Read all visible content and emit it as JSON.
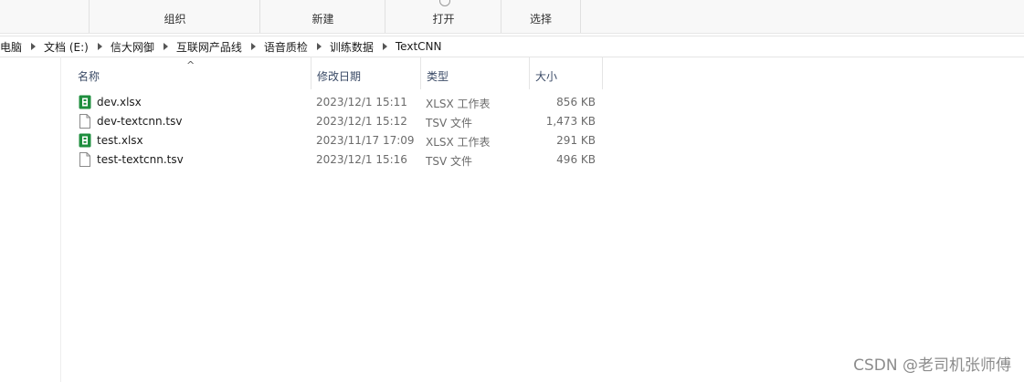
{
  "ribbon": {
    "groups": [
      {
        "label": "组织"
      },
      {
        "label": "新建"
      },
      {
        "label": "打开"
      },
      {
        "label": "选择"
      }
    ]
  },
  "address": {
    "crumbs": [
      "此电脑",
      "文档 (E:)",
      "信大网御",
      "互联网产品线",
      "语音质检",
      "训练数据",
      "TextCNN"
    ]
  },
  "columns": {
    "name": "名称",
    "date": "修改日期",
    "type": "类型",
    "size": "大小",
    "sort_glyph": "^"
  },
  "files": [
    {
      "name": "dev.xlsx",
      "date": "2023/12/1 15:11",
      "type": "XLSX 工作表",
      "size": "856 KB",
      "icon": "excel-icon"
    },
    {
      "name": "dev-textcnn.tsv",
      "date": "2023/12/1 15:12",
      "type": "TSV 文件",
      "size": "1,473 KB",
      "icon": "file-icon"
    },
    {
      "name": "test.xlsx",
      "date": "2023/11/17 17:09",
      "type": "XLSX 工作表",
      "size": "291 KB",
      "icon": "excel-icon"
    },
    {
      "name": "test-textcnn.tsv",
      "date": "2023/12/1 15:16",
      "type": "TSV 文件",
      "size": "496 KB",
      "icon": "file-icon"
    }
  ],
  "watermark": "CSDN @老司机张师傅",
  "colors": {
    "excel": "#1e8e3e",
    "header_text": "#3a4a66"
  }
}
